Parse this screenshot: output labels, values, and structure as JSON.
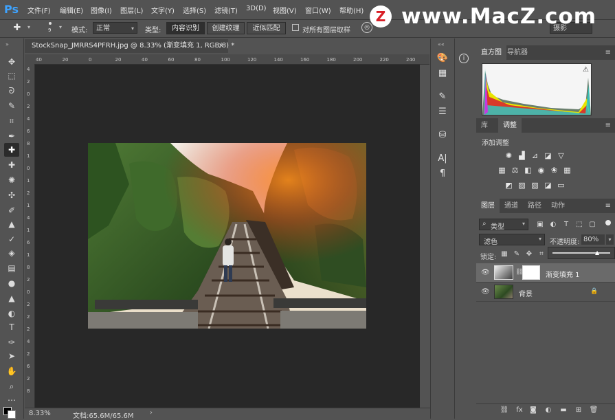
{
  "app": {
    "logo": "Ps"
  },
  "menu": [
    "文件(F)",
    "编辑(E)",
    "图像(I)",
    "图层(L)",
    "文字(Y)",
    "选择(S)",
    "滤镜(T)",
    "3D(D)",
    "视图(V)",
    "窗口(W)",
    "帮助(H)"
  ],
  "watermark": {
    "circle": "Z",
    "text": "www.MacZ.com"
  },
  "options": {
    "brush_size": "9",
    "mode_label": "模式:",
    "mode_value": "正常",
    "type_label": "类型:",
    "type_buttons": [
      "内容识别",
      "创建纹理",
      "近似匹配"
    ],
    "sample_all_label": "对所有图层取样",
    "workspace": "摄影"
  },
  "document": {
    "tab_title": "StockSnap_JMRRS4PFRH.jpg @ 8.33% (渐变填充 1, RGB/8) *",
    "close": "×",
    "ruler_top": [
      "40",
      "20",
      "0",
      "20",
      "40",
      "60",
      "80",
      "100",
      "120",
      "140",
      "160",
      "180",
      "200",
      "220",
      "240"
    ],
    "ruler_left": [
      "4",
      "2",
      "0",
      "2",
      "4",
      "6",
      "8",
      "1",
      "0",
      "1",
      "2",
      "1",
      "4",
      "1",
      "6",
      "1",
      "8",
      "2",
      "0",
      "2",
      "2",
      "2",
      "4",
      "2",
      "6",
      "2",
      "8"
    ],
    "zoom": "8.33%",
    "doc_info": "文档:65.6M/65.6M",
    "status_arrow": "›"
  },
  "panels": {
    "histogram_tabs": [
      "直方图",
      "导航器"
    ],
    "adjust_tabs": [
      "库",
      "调整"
    ],
    "adjust_title": "添加调整",
    "layers_tabs": [
      "图层",
      "通道",
      "路径",
      "动作"
    ],
    "filter_kind": "类型",
    "blend_mode": "滤色",
    "opacity_label": "不透明度:",
    "opacity_value": "80%",
    "lock_label": "锁定:",
    "layers": [
      {
        "name": "渐变填充 1",
        "selected": true
      },
      {
        "name": "背景",
        "selected": false
      }
    ]
  },
  "colors": {
    "accent": "#3ea3ff",
    "panel": "#535353",
    "canvas": "#282828"
  }
}
